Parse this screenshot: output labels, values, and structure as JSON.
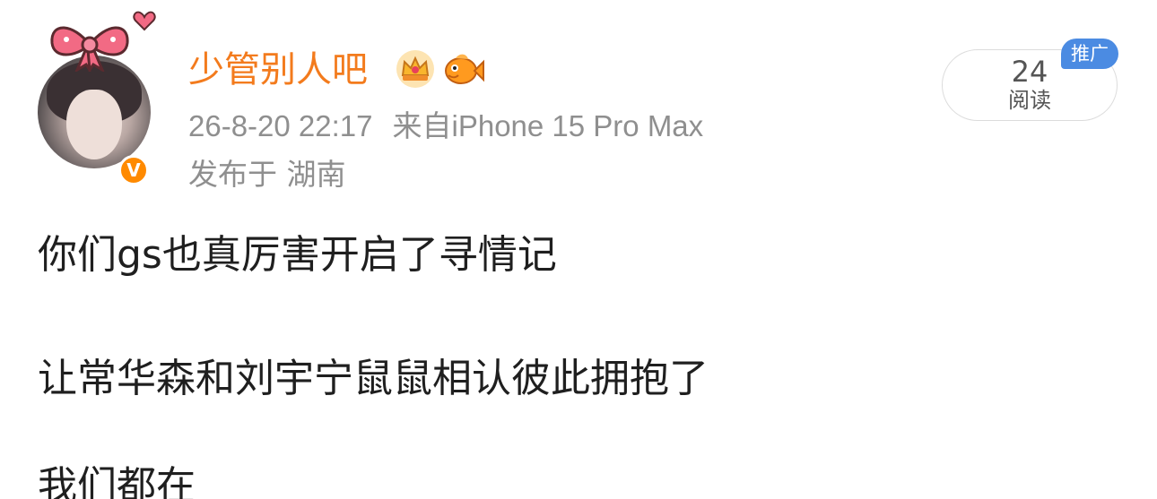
{
  "post": {
    "username": "少管别人吧",
    "timestamp": "26-8-20 22:17",
    "source_prefix": "来自",
    "source_device": "iPhone 15 Pro Max",
    "location": "发布于 湖南",
    "verified_badge": "V",
    "read_count": "24",
    "read_label": "阅读",
    "promo_tag": "推广",
    "content_lines": [
      "你们gs也真厉害开启了寻情记",
      "让常华森和刘宇宁鼠鼠相认彼此拥抱了",
      "我们都在"
    ],
    "icons": {
      "avatar_decoration": "pink-bow-icon",
      "avatar_heart": "heart-icon",
      "name_badge_1": "crown-icon",
      "name_badge_2": "fish-icon"
    },
    "colors": {
      "username": "#f37b1d",
      "meta": "#8f8f8f",
      "badge": "#ff8a00",
      "promo": "#4b8be2",
      "bow": "#f0627c"
    }
  }
}
